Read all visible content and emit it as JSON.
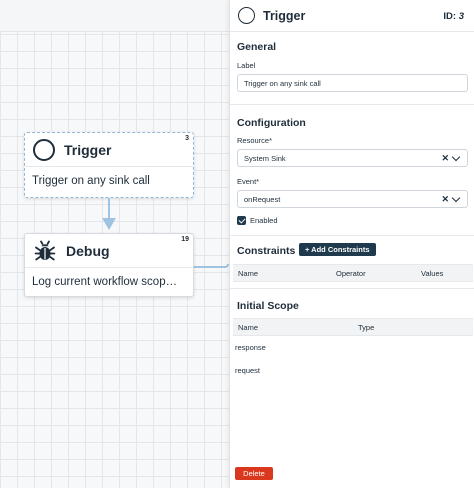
{
  "canvas": {
    "nodes": [
      {
        "title": "Trigger",
        "id": "3",
        "body": "Trigger on any sink call",
        "icon": "circle-icon"
      },
      {
        "title": "Debug",
        "id": "19",
        "body": "Log current workflow scop…",
        "icon": "bug-icon"
      }
    ]
  },
  "panel": {
    "title": "Trigger",
    "id_label": "ID:",
    "id_value": "3",
    "general": {
      "title": "General",
      "label_label": "Label",
      "label_value": "Trigger on any sink call"
    },
    "configuration": {
      "title": "Configuration",
      "resource_label": "Resource*",
      "resource_value": "System Sink",
      "event_label": "Event*",
      "event_value": "onRequest",
      "enabled_label": "Enabled",
      "enabled": true
    },
    "constraints": {
      "title": "Constraints",
      "add_button": "+ Add Constraints",
      "columns": [
        "Name",
        "Operator",
        "Values"
      ]
    },
    "initial_scope": {
      "title": "Initial Scope",
      "columns": [
        "Name",
        "Type"
      ],
      "rows": [
        "response",
        "request"
      ]
    },
    "delete_button": "Delete"
  },
  "colors": {
    "primary_dark": "#1f3a4d",
    "danger": "#d9381e",
    "connector": "#9fc4e2"
  }
}
